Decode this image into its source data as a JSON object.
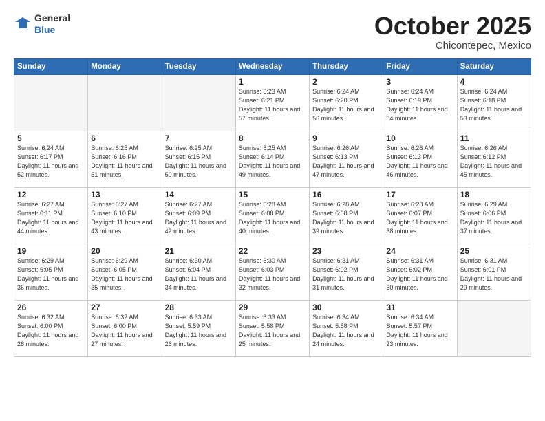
{
  "header": {
    "logo_general": "General",
    "logo_blue": "Blue",
    "month": "October 2025",
    "location": "Chicontepec, Mexico"
  },
  "days_of_week": [
    "Sunday",
    "Monday",
    "Tuesday",
    "Wednesday",
    "Thursday",
    "Friday",
    "Saturday"
  ],
  "weeks": [
    [
      {
        "day": "",
        "sunrise": "",
        "sunset": "",
        "daylight": "",
        "empty": true
      },
      {
        "day": "",
        "sunrise": "",
        "sunset": "",
        "daylight": "",
        "empty": true
      },
      {
        "day": "",
        "sunrise": "",
        "sunset": "",
        "daylight": "",
        "empty": true
      },
      {
        "day": "1",
        "sunrise": "Sunrise: 6:23 AM",
        "sunset": "Sunset: 6:21 PM",
        "daylight": "Daylight: 11 hours and 57 minutes.",
        "empty": false
      },
      {
        "day": "2",
        "sunrise": "Sunrise: 6:24 AM",
        "sunset": "Sunset: 6:20 PM",
        "daylight": "Daylight: 11 hours and 56 minutes.",
        "empty": false
      },
      {
        "day": "3",
        "sunrise": "Sunrise: 6:24 AM",
        "sunset": "Sunset: 6:19 PM",
        "daylight": "Daylight: 11 hours and 54 minutes.",
        "empty": false
      },
      {
        "day": "4",
        "sunrise": "Sunrise: 6:24 AM",
        "sunset": "Sunset: 6:18 PM",
        "daylight": "Daylight: 11 hours and 53 minutes.",
        "empty": false
      }
    ],
    [
      {
        "day": "5",
        "sunrise": "Sunrise: 6:24 AM",
        "sunset": "Sunset: 6:17 PM",
        "daylight": "Daylight: 11 hours and 52 minutes.",
        "empty": false
      },
      {
        "day": "6",
        "sunrise": "Sunrise: 6:25 AM",
        "sunset": "Sunset: 6:16 PM",
        "daylight": "Daylight: 11 hours and 51 minutes.",
        "empty": false
      },
      {
        "day": "7",
        "sunrise": "Sunrise: 6:25 AM",
        "sunset": "Sunset: 6:15 PM",
        "daylight": "Daylight: 11 hours and 50 minutes.",
        "empty": false
      },
      {
        "day": "8",
        "sunrise": "Sunrise: 6:25 AM",
        "sunset": "Sunset: 6:14 PM",
        "daylight": "Daylight: 11 hours and 49 minutes.",
        "empty": false
      },
      {
        "day": "9",
        "sunrise": "Sunrise: 6:26 AM",
        "sunset": "Sunset: 6:13 PM",
        "daylight": "Daylight: 11 hours and 47 minutes.",
        "empty": false
      },
      {
        "day": "10",
        "sunrise": "Sunrise: 6:26 AM",
        "sunset": "Sunset: 6:13 PM",
        "daylight": "Daylight: 11 hours and 46 minutes.",
        "empty": false
      },
      {
        "day": "11",
        "sunrise": "Sunrise: 6:26 AM",
        "sunset": "Sunset: 6:12 PM",
        "daylight": "Daylight: 11 hours and 45 minutes.",
        "empty": false
      }
    ],
    [
      {
        "day": "12",
        "sunrise": "Sunrise: 6:27 AM",
        "sunset": "Sunset: 6:11 PM",
        "daylight": "Daylight: 11 hours and 44 minutes.",
        "empty": false
      },
      {
        "day": "13",
        "sunrise": "Sunrise: 6:27 AM",
        "sunset": "Sunset: 6:10 PM",
        "daylight": "Daylight: 11 hours and 43 minutes.",
        "empty": false
      },
      {
        "day": "14",
        "sunrise": "Sunrise: 6:27 AM",
        "sunset": "Sunset: 6:09 PM",
        "daylight": "Daylight: 11 hours and 42 minutes.",
        "empty": false
      },
      {
        "day": "15",
        "sunrise": "Sunrise: 6:28 AM",
        "sunset": "Sunset: 6:08 PM",
        "daylight": "Daylight: 11 hours and 40 minutes.",
        "empty": false
      },
      {
        "day": "16",
        "sunrise": "Sunrise: 6:28 AM",
        "sunset": "Sunset: 6:08 PM",
        "daylight": "Daylight: 11 hours and 39 minutes.",
        "empty": false
      },
      {
        "day": "17",
        "sunrise": "Sunrise: 6:28 AM",
        "sunset": "Sunset: 6:07 PM",
        "daylight": "Daylight: 11 hours and 38 minutes.",
        "empty": false
      },
      {
        "day": "18",
        "sunrise": "Sunrise: 6:29 AM",
        "sunset": "Sunset: 6:06 PM",
        "daylight": "Daylight: 11 hours and 37 minutes.",
        "empty": false
      }
    ],
    [
      {
        "day": "19",
        "sunrise": "Sunrise: 6:29 AM",
        "sunset": "Sunset: 6:05 PM",
        "daylight": "Daylight: 11 hours and 36 minutes.",
        "empty": false
      },
      {
        "day": "20",
        "sunrise": "Sunrise: 6:29 AM",
        "sunset": "Sunset: 6:05 PM",
        "daylight": "Daylight: 11 hours and 35 minutes.",
        "empty": false
      },
      {
        "day": "21",
        "sunrise": "Sunrise: 6:30 AM",
        "sunset": "Sunset: 6:04 PM",
        "daylight": "Daylight: 11 hours and 34 minutes.",
        "empty": false
      },
      {
        "day": "22",
        "sunrise": "Sunrise: 6:30 AM",
        "sunset": "Sunset: 6:03 PM",
        "daylight": "Daylight: 11 hours and 32 minutes.",
        "empty": false
      },
      {
        "day": "23",
        "sunrise": "Sunrise: 6:31 AM",
        "sunset": "Sunset: 6:02 PM",
        "daylight": "Daylight: 11 hours and 31 minutes.",
        "empty": false
      },
      {
        "day": "24",
        "sunrise": "Sunrise: 6:31 AM",
        "sunset": "Sunset: 6:02 PM",
        "daylight": "Daylight: 11 hours and 30 minutes.",
        "empty": false
      },
      {
        "day": "25",
        "sunrise": "Sunrise: 6:31 AM",
        "sunset": "Sunset: 6:01 PM",
        "daylight": "Daylight: 11 hours and 29 minutes.",
        "empty": false
      }
    ],
    [
      {
        "day": "26",
        "sunrise": "Sunrise: 6:32 AM",
        "sunset": "Sunset: 6:00 PM",
        "daylight": "Daylight: 11 hours and 28 minutes.",
        "empty": false
      },
      {
        "day": "27",
        "sunrise": "Sunrise: 6:32 AM",
        "sunset": "Sunset: 6:00 PM",
        "daylight": "Daylight: 11 hours and 27 minutes.",
        "empty": false
      },
      {
        "day": "28",
        "sunrise": "Sunrise: 6:33 AM",
        "sunset": "Sunset: 5:59 PM",
        "daylight": "Daylight: 11 hours and 26 minutes.",
        "empty": false
      },
      {
        "day": "29",
        "sunrise": "Sunrise: 6:33 AM",
        "sunset": "Sunset: 5:58 PM",
        "daylight": "Daylight: 11 hours and 25 minutes.",
        "empty": false
      },
      {
        "day": "30",
        "sunrise": "Sunrise: 6:34 AM",
        "sunset": "Sunset: 5:58 PM",
        "daylight": "Daylight: 11 hours and 24 minutes.",
        "empty": false
      },
      {
        "day": "31",
        "sunrise": "Sunrise: 6:34 AM",
        "sunset": "Sunset: 5:57 PM",
        "daylight": "Daylight: 11 hours and 23 minutes.",
        "empty": false
      },
      {
        "day": "",
        "sunrise": "",
        "sunset": "",
        "daylight": "",
        "empty": true
      }
    ]
  ]
}
